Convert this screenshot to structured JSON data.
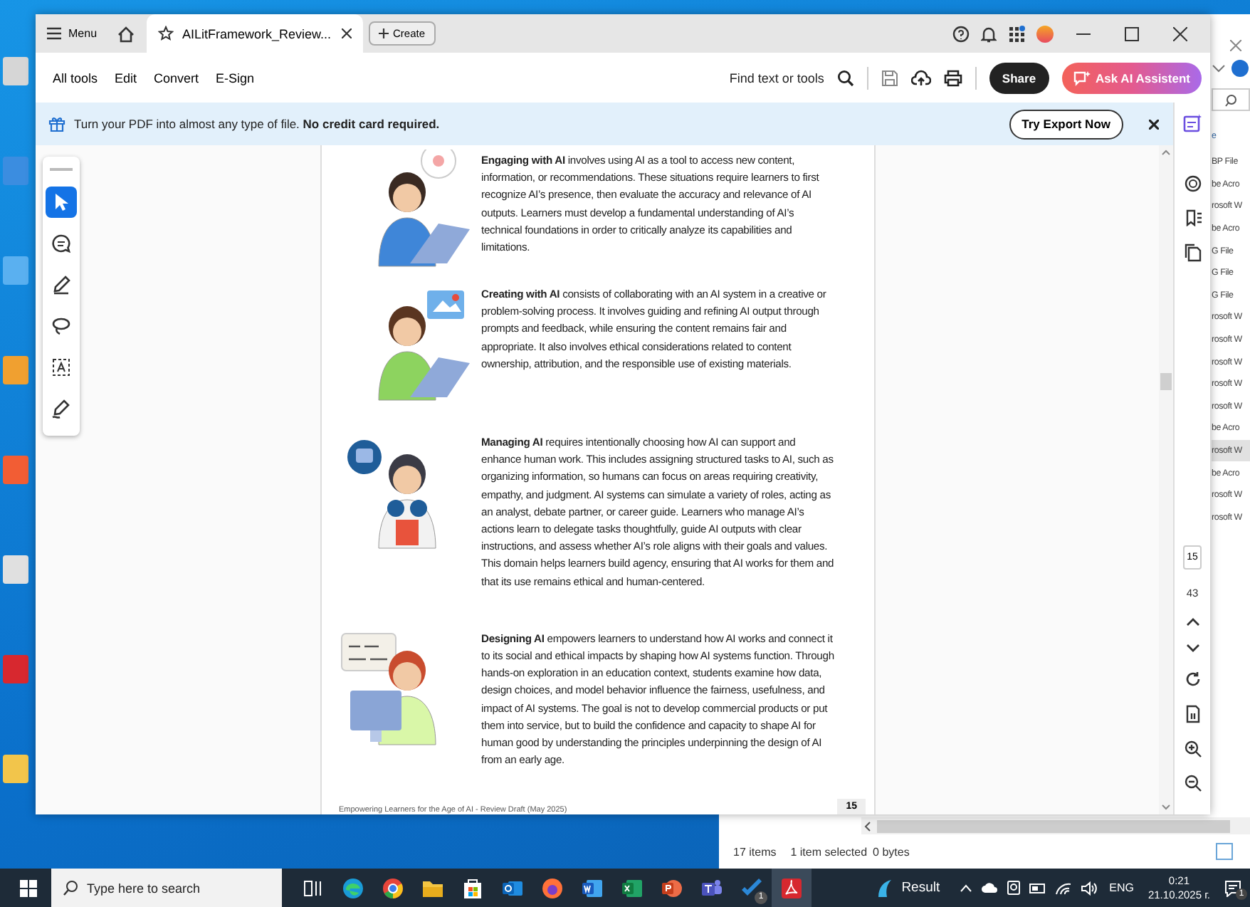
{
  "explorer": {
    "column_header": "e",
    "rows": [
      {
        "text": "BP File",
        "selected": false
      },
      {
        "text": "be Acro",
        "selected": false
      },
      {
        "text": "rosoft W",
        "selected": false
      },
      {
        "text": "be Acro",
        "selected": false
      },
      {
        "text": "G File",
        "selected": false
      },
      {
        "text": "G File",
        "selected": false
      },
      {
        "text": "G File",
        "selected": false
      },
      {
        "text": "rosoft W",
        "selected": false
      },
      {
        "text": "rosoft W",
        "selected": false
      },
      {
        "text": "rosoft W",
        "selected": false
      },
      {
        "text": "rosoft W",
        "selected": false
      },
      {
        "text": "rosoft W",
        "selected": false
      },
      {
        "text": "be Acro",
        "selected": false
      },
      {
        "text": "rosoft W",
        "selected": true
      },
      {
        "text": "be Acro",
        "selected": false
      },
      {
        "text": "rosoft W",
        "selected": false
      },
      {
        "text": "rosoft W",
        "selected": false
      }
    ],
    "status": {
      "count": "17 items",
      "selection": "1 item selected",
      "size": "0 bytes"
    }
  },
  "window": {
    "menu_label": "Menu",
    "tabs": [
      {
        "label": "AILitFramework_Review...",
        "selected": true
      }
    ],
    "create_label": "Create",
    "toolbar": [
      "All tools",
      "Edit",
      "Convert",
      "E-Sign"
    ],
    "find_label": "Find text or tools",
    "share_label": "Share",
    "ai_label": "Ask AI Assistent",
    "banner": {
      "text": "Turn your PDF into almost any type of file. **No credit card required.**",
      "button": "Try Export Now"
    },
    "tools": [
      {
        "kind": "select",
        "selected": true
      },
      {
        "kind": "comment",
        "selected": false
      },
      {
        "kind": "pen",
        "selected": false
      },
      {
        "kind": "lasso",
        "selected": false
      },
      {
        "kind": "textbox",
        "selected": false
      },
      {
        "kind": "sign",
        "selected": false
      }
    ],
    "page": {
      "sections": [
        {
          "text": "**Engaging with AI** involves using AI as a tool to access new content, information, or recommendations. These situations require learners to first recognize AI’s presence, then evaluate the accuracy and relevance of AI outputs. Learners must develop a fundamental understanding of AI’s technical foundations in order to critically analyze its capabilities and limitations."
        },
        {
          "text": "**Creating with AI** consists of collaborating with an AI system in a creative or problem-solving process. It involves guiding and refining AI output through prompts and feedback, while ensuring the content remains fair and appropriate. It also involves ethical considerations related to content ownership, attribution, and the responsible use of existing materials."
        },
        {
          "text": "**Managing AI** requires intentionally choosing how AI can support and enhance human work. This includes assigning structured tasks to AI, such as organizing information, so humans can focus on areas requiring creativity, empathy, and judgment. AI systems can simulate a variety of roles, acting as an analyst, debate partner, or career guide. Learners who manage AI’s actions learn to delegate tasks thoughtfully, guide AI outputs with clear instructions, and assess whether AI’s role aligns with their goals and values. This domain helps learners build agency, ensuring that AI works for them and that its use remains ethical and human-centered."
        },
        {
          "text": "**Designing AI** empowers learners to understand how AI works and connect it to its social and ethical impacts by shaping how AI systems function. Through hands-on exploration in an education context, students examine how data, design choices, and model behavior influence the fairness, usefulness, and impact of AI systems. The goal is not to develop commercial products or put them into service, but to build the confidence and capacity to shape AI for human good by understanding the principles underpinning the design of AI from an early age."
        }
      ],
      "footer": "Empowering Learners for the Age of AI - Review Draft (May 2025)",
      "page_badge": "15"
    },
    "rail": {
      "current_page": "15",
      "total_pages": "43"
    }
  },
  "taskbar": {
    "search_placeholder": "Type here to search",
    "apps": [
      {
        "kind": "taskview",
        "selected": false
      },
      {
        "kind": "edge",
        "selected": false
      },
      {
        "kind": "chrome",
        "selected": false
      },
      {
        "kind": "files",
        "selected": false
      },
      {
        "kind": "store",
        "selected": false
      },
      {
        "kind": "outlook",
        "selected": false
      },
      {
        "kind": "firefox",
        "selected": false
      },
      {
        "kind": "word",
        "selected": false
      },
      {
        "kind": "excel",
        "selected": false
      },
      {
        "kind": "powerpoint",
        "selected": false
      },
      {
        "kind": "teams",
        "selected": false
      },
      {
        "kind": "todo",
        "selected": false,
        "badge": "1"
      },
      {
        "kind": "acrobat",
        "selected": true
      }
    ],
    "weather": "Result",
    "language": "ENG",
    "time": "0:21",
    "date": "21.10.2025 г.",
    "notification_badge": "1"
  }
}
